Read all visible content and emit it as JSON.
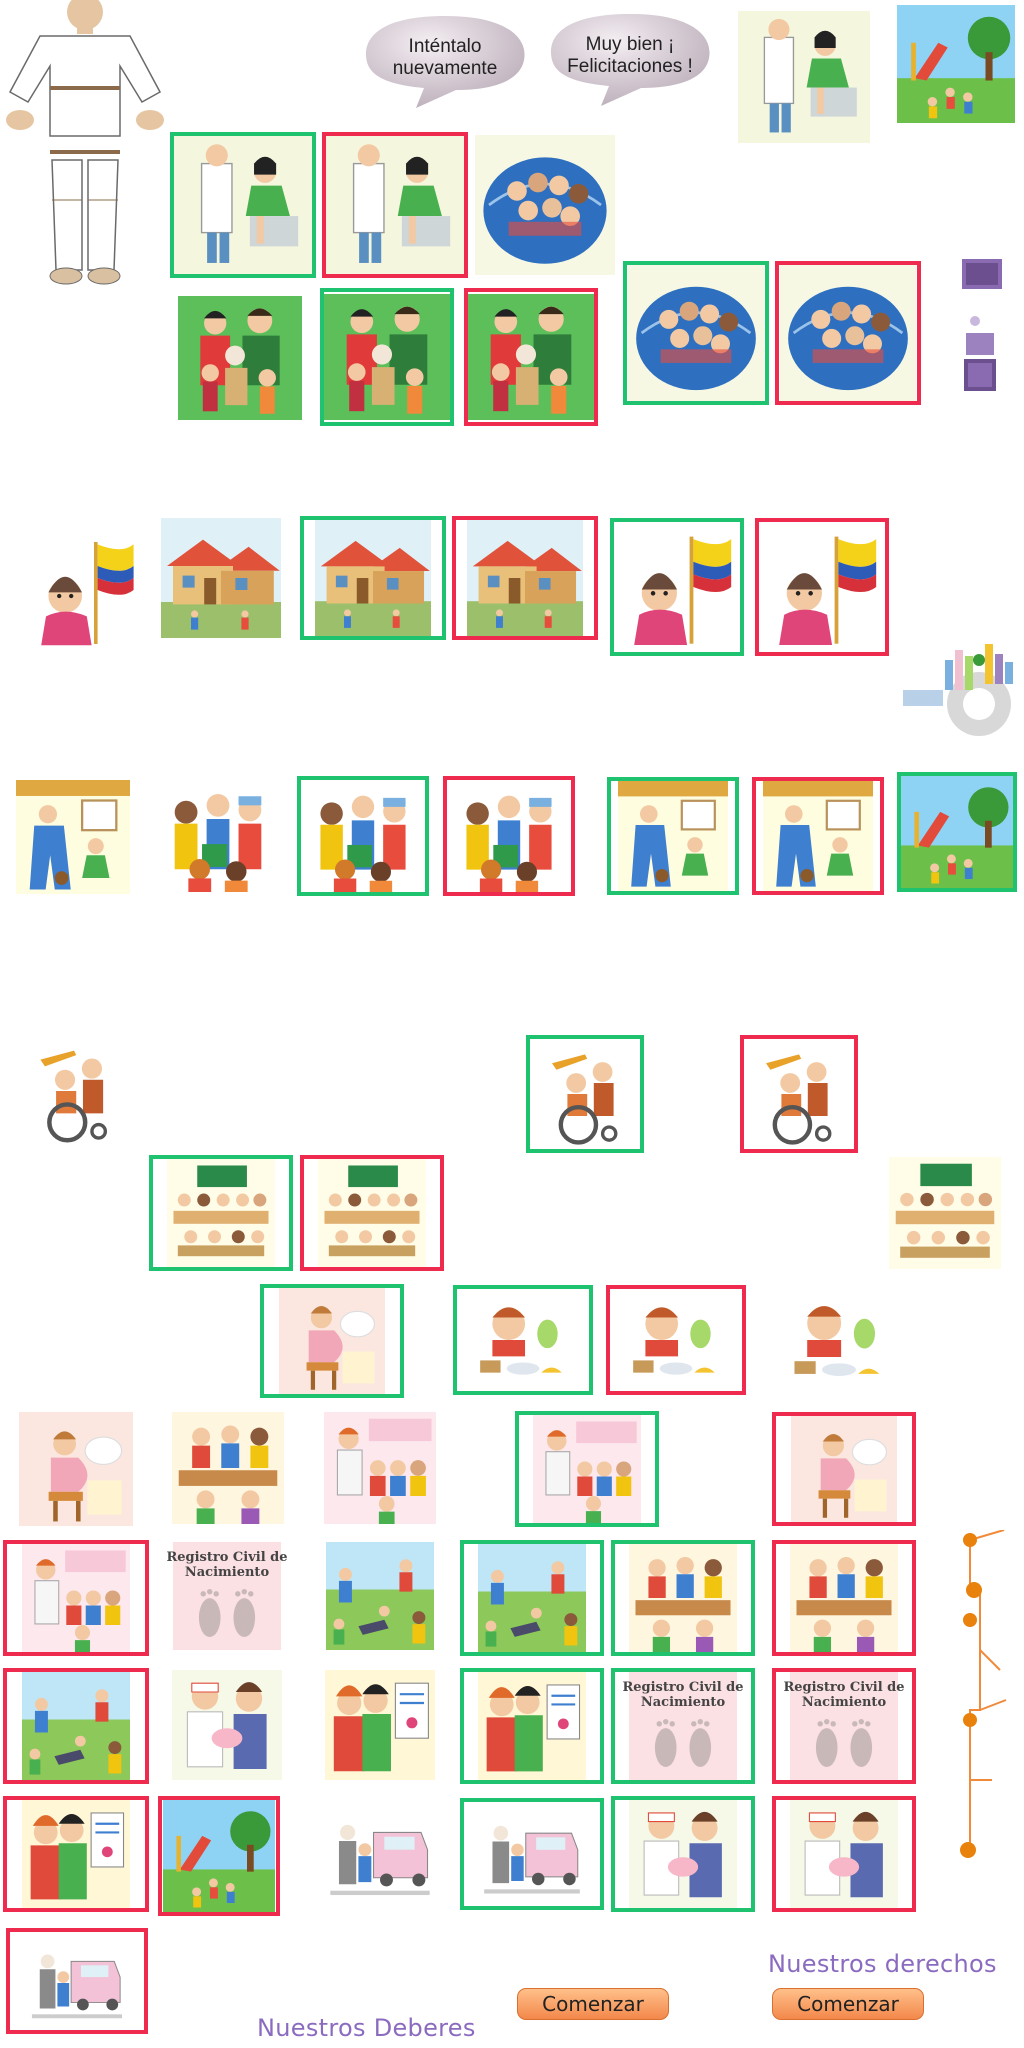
{
  "bubbles": {
    "try_again": "Inténtalo nuevamente",
    "well_done": "Muy bien ¡ Felicitaciones !"
  },
  "registro_label": "Registro Civil de Nacimiento",
  "buttons": {
    "start_left": "Comenzar",
    "start_right": "Comenzar"
  },
  "titles": {
    "rights": "Nuestros derechos",
    "duties": "Nuestros Deberes"
  },
  "colors": {
    "correct_frame": "#1fc36f",
    "wrong_frame": "#ee2a4e",
    "title_purple": "#8b6bc0",
    "button_orange": "#f3884b"
  },
  "icons": {
    "costume": "child-costume-icon",
    "city_wheel": "city-wheel-icon",
    "purple_shapes": "purple-shapes-icon",
    "orange_path": "orange-path-icon"
  }
}
